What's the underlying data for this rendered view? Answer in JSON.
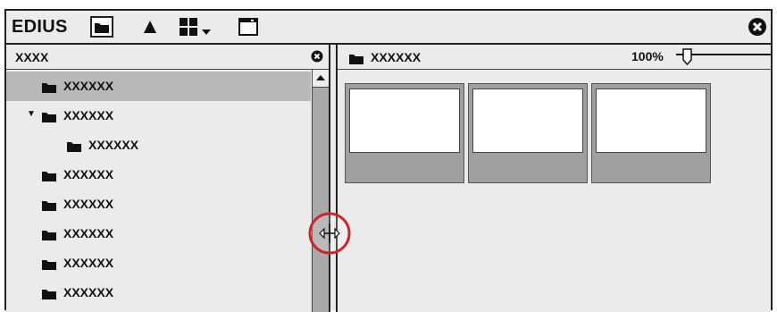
{
  "app": {
    "title": "EDIUS",
    "close_icon": "close-circle-icon"
  },
  "toolbar": {
    "icons": [
      "folder-view-icon",
      "up-triangle-icon",
      "view-mode-dropdown-icon",
      "window-icon"
    ]
  },
  "folder_tree": {
    "header_label": "XXXX",
    "items": [
      {
        "label": "XXXXXX",
        "selected": true,
        "expanded": false,
        "level": 0
      },
      {
        "label": "XXXXXX",
        "selected": false,
        "expanded": true,
        "level": 0
      },
      {
        "label": "XXXXXX",
        "selected": false,
        "expanded": false,
        "level": 1
      },
      {
        "label": "XXXXXX",
        "selected": false,
        "expanded": false,
        "level": 0
      },
      {
        "label": "XXXXXX",
        "selected": false,
        "expanded": false,
        "level": 0
      },
      {
        "label": "XXXXXX",
        "selected": false,
        "expanded": false,
        "level": 0
      },
      {
        "label": "XXXXXX",
        "selected": false,
        "expanded": false,
        "level": 0
      },
      {
        "label": "XXXXXX",
        "selected": false,
        "expanded": false,
        "level": 0
      }
    ]
  },
  "clip_view": {
    "folder_label": "XXXXXX",
    "zoom_label": "100%",
    "clip_count": 3
  },
  "colors": {
    "selected_row": "#b9b9b9",
    "panel_bg": "#ebebeb",
    "clip_bg": "#9f9f9f",
    "cursor_ring": "#d0242b"
  }
}
